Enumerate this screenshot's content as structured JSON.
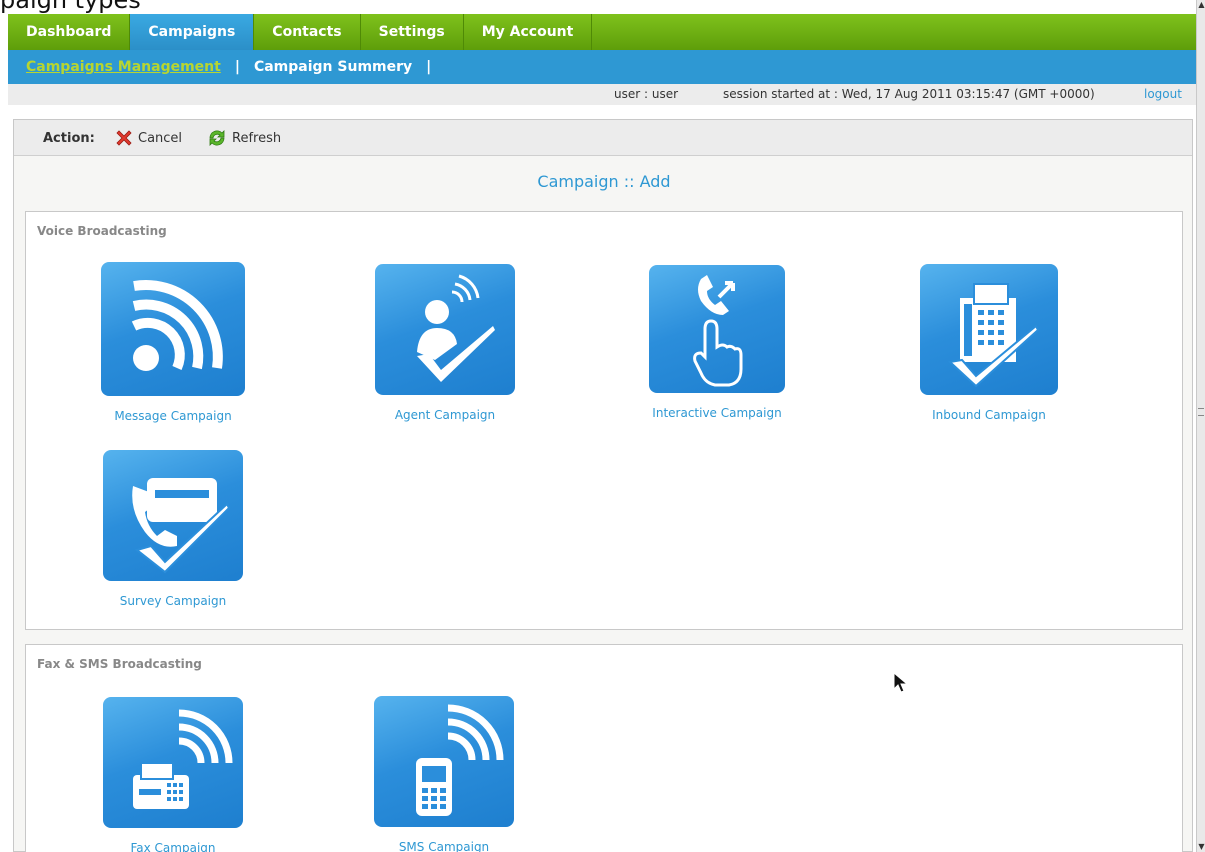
{
  "page_fragment": "paign types",
  "nav": {
    "tabs": [
      {
        "label": "Dashboard"
      },
      {
        "label": "Campaigns"
      },
      {
        "label": "Contacts"
      },
      {
        "label": "Settings"
      },
      {
        "label": "My Account"
      }
    ],
    "active_tab": "Campaigns"
  },
  "subnav": {
    "items": [
      {
        "label": "Campaigns Management"
      },
      {
        "label": "Campaign Summery"
      }
    ],
    "separator": "|"
  },
  "userbar": {
    "user": "user : user",
    "session": "session started at : Wed, 17 Aug 2011 03:15:47 (GMT +0000)",
    "logout": "logout"
  },
  "actions": {
    "label": "Action:",
    "cancel": "Cancel",
    "refresh": "Refresh"
  },
  "heading": "Campaign :: Add",
  "sections": {
    "voice": {
      "title": "Voice Broadcasting",
      "tiles": [
        {
          "label": "Message Campaign",
          "icon": "broadcast-waves-icon"
        },
        {
          "label": "Agent Campaign",
          "icon": "agent-check-icon"
        },
        {
          "label": "Interactive Campaign",
          "icon": "phone-press-icon"
        },
        {
          "label": "Inbound Campaign",
          "icon": "desk-phone-check-icon"
        },
        {
          "label": "Survey Campaign",
          "icon": "phone-check-icon"
        }
      ]
    },
    "faxsms": {
      "title": "Fax & SMS Broadcasting",
      "tiles": [
        {
          "label": "Fax Campaign",
          "icon": "fax-waves-icon"
        },
        {
          "label": "SMS Campaign",
          "icon": "mobile-waves-icon"
        }
      ]
    }
  },
  "colors": {
    "nav_green": "#6fb212",
    "accent_blue": "#2e98d3",
    "active_sublink": "#b7d531"
  }
}
